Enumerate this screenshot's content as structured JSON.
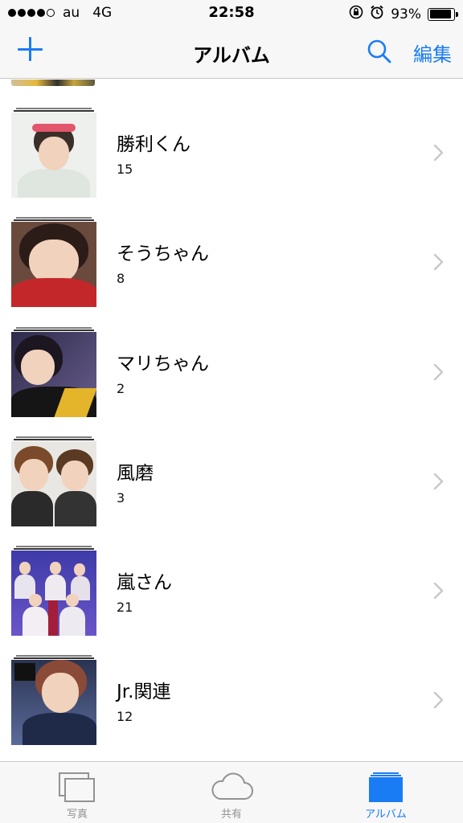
{
  "status_bar": {
    "carrier": "au",
    "network": "4G",
    "time": "22:58",
    "battery_percent": "93%",
    "battery_level": 0.93,
    "signal_bars_filled": 4,
    "signal_bars_total": 5
  },
  "nav_bar": {
    "title": "アルバム",
    "edit_label": "編集",
    "add_icon": "plus-icon",
    "search_icon": "search-icon"
  },
  "albums": [
    {
      "name": "勝利くん",
      "count": "15"
    },
    {
      "name": "そうちゃん",
      "count": "8"
    },
    {
      "name": "マリちゃん",
      "count": "2"
    },
    {
      "name": "風磨",
      "count": "3"
    },
    {
      "name": "嵐さん",
      "count": "21"
    },
    {
      "name": "Jr.関連",
      "count": "12"
    }
  ],
  "tab_bar": {
    "tabs": [
      {
        "label": "写真",
        "icon": "photos-icon",
        "active": false
      },
      {
        "label": "共有",
        "icon": "cloud-icon",
        "active": false
      },
      {
        "label": "アルバム",
        "icon": "albums-icon",
        "active": true
      }
    ]
  },
  "colors": {
    "accent": "#1a7cf4",
    "inactive": "#929292",
    "bar_background": "#f7f7f7"
  }
}
